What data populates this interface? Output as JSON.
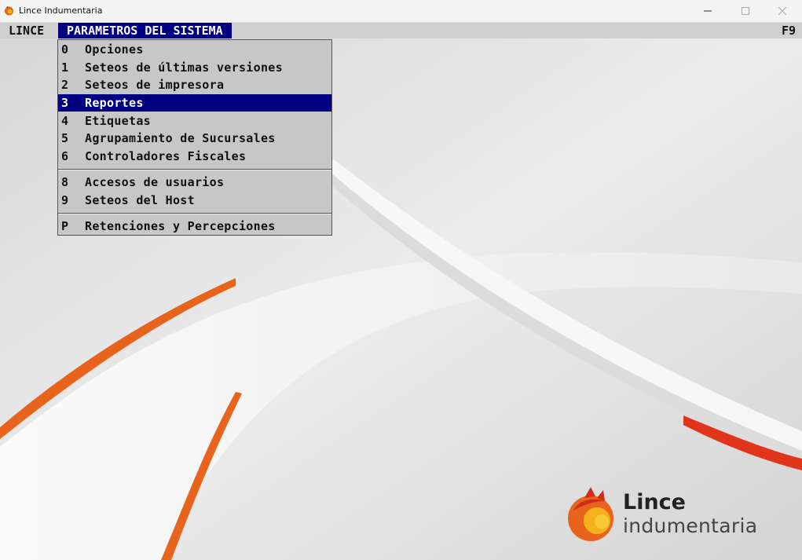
{
  "window": {
    "title": "Lince Indumentaria",
    "controls": {
      "minimize": "minimize-icon",
      "maximize": "maximize-icon",
      "close": "close-icon"
    }
  },
  "menubar": {
    "app_menu": "LINCE",
    "active_menu": "PARAMETROS DEL SISTEMA",
    "hotkey": "F9"
  },
  "dropdown": {
    "items": [
      {
        "key": "0",
        "label": "Opciones",
        "selected": false
      },
      {
        "key": "1",
        "label": "Seteos de últimas versiones",
        "selected": false
      },
      {
        "key": "2",
        "label": "Seteos de impresora",
        "selected": false
      },
      {
        "key": "3",
        "label": "Reportes",
        "selected": true
      },
      {
        "key": "4",
        "label": "Etiquetas",
        "selected": false
      },
      {
        "key": "5",
        "label": "Agrupamiento de Sucursales",
        "selected": false
      },
      {
        "key": "6",
        "label": "Controladores Fiscales",
        "selected": false
      },
      {
        "key": "8",
        "label": "Accesos de usuarios",
        "selected": false
      },
      {
        "key": "9",
        "label": "Seteos del Host",
        "selected": false
      },
      {
        "key": "P",
        "label": "Retenciones y Percepciones",
        "selected": false
      }
    ]
  },
  "logo": {
    "brand": "Lince",
    "subtitle": "indumentaria"
  },
  "colors": {
    "menu_highlight": "#000080",
    "menu_background": "#c7c7c7",
    "accent_orange": "#e8641c"
  }
}
